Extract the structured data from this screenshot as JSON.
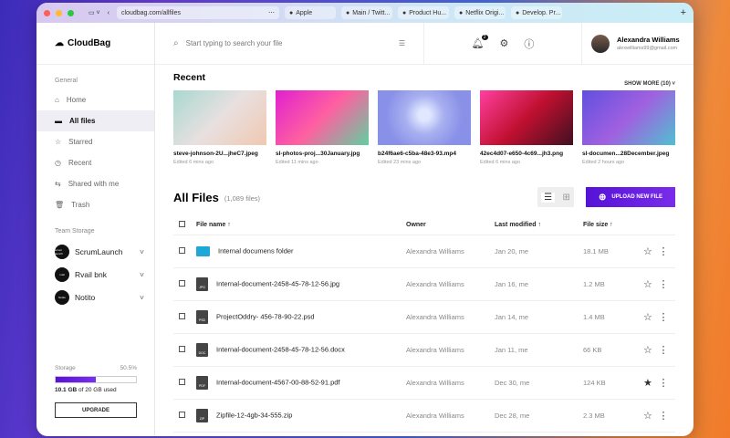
{
  "browser": {
    "url": "cloudbag.com/allfiles",
    "tabs": [
      "Apple",
      "Main / Twitt...",
      "Product Hu...",
      "Netflix Origi...",
      "Develop. Pr..."
    ]
  },
  "app": {
    "name": "CloudBag"
  },
  "sidebar": {
    "general_label": "General",
    "items": [
      {
        "label": "Home",
        "icon": "home-icon"
      },
      {
        "label": "All files",
        "icon": "folder-icon",
        "active": true
      },
      {
        "label": "Starred",
        "icon": "star-icon"
      },
      {
        "label": "Recent",
        "icon": "clock-icon"
      },
      {
        "label": "Shared with me",
        "icon": "share-icon"
      },
      {
        "label": "Trash",
        "icon": "trash-icon"
      }
    ],
    "team_label": "Team Storage",
    "teams": [
      {
        "name": "ScrumLaunch",
        "badge": "scrum launch"
      },
      {
        "name": "Rvail bnk",
        "badge": "rvail"
      },
      {
        "name": "Notito",
        "badge": "Notito"
      }
    ],
    "storage": {
      "label": "Storage",
      "percent": "50.5%",
      "fraction": 0.505,
      "used": "10.1 GB",
      "of": "of 20 GB used",
      "upgrade": "UPGRADE"
    }
  },
  "header": {
    "search_placeholder": "Start typing to search your file",
    "notifications": "2",
    "user": {
      "name": "Alexandra Williams",
      "email": "alexwilliams99@gmail.com"
    }
  },
  "recent": {
    "title": "Recent",
    "show_more": "SHOW MORE (10)",
    "items": [
      {
        "name": "steve-johnson-2U...jheC7.jpeg",
        "edited": "Edited 6 mins ago",
        "bg": "linear-gradient(135deg,#a8d8d0,#e8e0e0 50%,#f0c8b0)"
      },
      {
        "name": "sl-photos-proj...30January.jpg",
        "edited": "Edited 11 mins ago",
        "bg": "linear-gradient(135deg,#e020d0,#ff60a0 50%,#60d0a0)"
      },
      {
        "name": "b24f6ae6-c5ba-48e3-93.mp4",
        "edited": "Edited 23 mins ago",
        "bg": "radial-gradient(circle at 50% 45%,#e0e8ff 10%,#a8b0f0 35%,#8890e8 70%)"
      },
      {
        "name": "42ec4d07-e650-4c69...jh3.png",
        "edited": "Edited 6 mins ago",
        "bg": "linear-gradient(135deg,#ff40a0,#c01030 50%,#401020)"
      },
      {
        "name": "sl-documen...28December.jpeg",
        "edited": "Edited 2 hours ago",
        "bg": "linear-gradient(135deg,#6050e0,#a060e0 50%,#50c0d0)"
      }
    ]
  },
  "files": {
    "title": "All Files",
    "count": "(1,089 files)",
    "upload": "UPLOAD NEW FILE",
    "columns": {
      "name": "File name",
      "owner": "Owner",
      "modified": "Last modified",
      "size": "File size"
    },
    "rows": [
      {
        "name": "Internal documens folder",
        "type": "folder",
        "owner": "Alexandra Williams",
        "modified": "Jan 20, me",
        "size": "18.1 MB",
        "starred": false
      },
      {
        "name": "Internal-document-2458-45-78-12-56.jpg",
        "type": "JPG",
        "owner": "Alexandra Williams",
        "modified": "Jan 16, me",
        "size": "1.2 MB",
        "starred": false
      },
      {
        "name": "ProjectOddry- 456-78-90-22.psd",
        "type": "PSD",
        "owner": "Alexandra Williams",
        "modified": "Jan 14, me",
        "size": "1.4 MB",
        "starred": false
      },
      {
        "name": "Internal-document-2458-45-78-12-56.docx",
        "type": "DOC",
        "owner": "Alexandra Williams",
        "modified": "Jan 11, me",
        "size": "66 KB",
        "starred": false
      },
      {
        "name": "Internal-document-4567-00-88-52-91.pdf",
        "type": "PDF",
        "owner": "Alexandra Williams",
        "modified": "Dec 30, me",
        "size": "124 KB",
        "starred": true
      },
      {
        "name": "Zipfile-12-4gb-34-555.zip",
        "type": "ZIP",
        "owner": "Alexandra Williams",
        "modified": "Dec 28, me",
        "size": "2.3 MB",
        "starred": false
      }
    ]
  }
}
